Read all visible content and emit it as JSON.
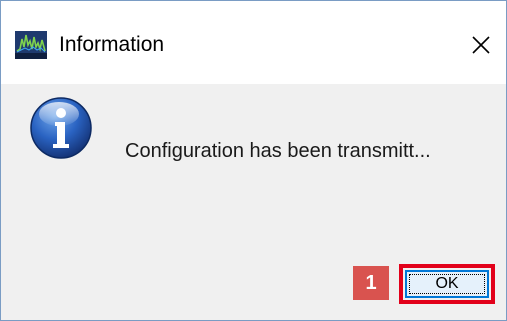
{
  "window": {
    "title": "Information",
    "app_icon": "waveform-app-icon",
    "close_icon": "close-icon"
  },
  "dialog": {
    "icon": "info-icon",
    "message": "Configuration has been transmitt..."
  },
  "annotation": {
    "step_number": "1",
    "badge_color": "#d9534f",
    "highlight_color": "#e2001a"
  },
  "buttons": {
    "ok_label": "OK"
  }
}
